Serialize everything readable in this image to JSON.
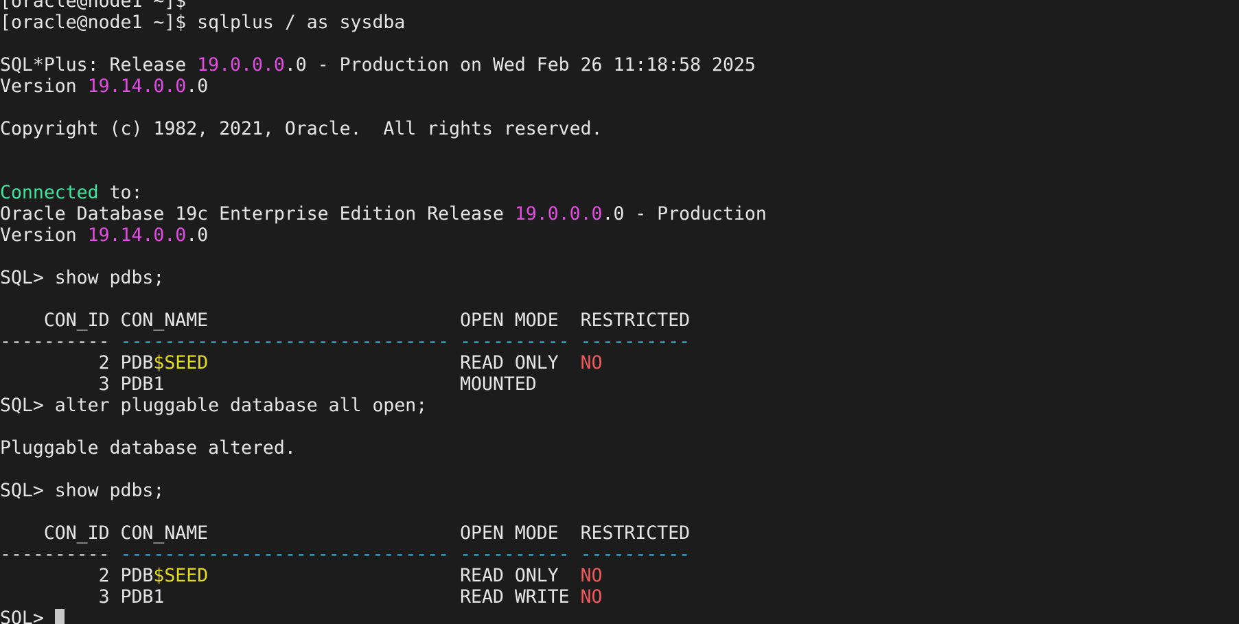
{
  "terminal": {
    "colors": {
      "background": "#1c1c1c",
      "foreground": "#e6e6e6",
      "magenta": "#e44de4",
      "green": "#3ee6a0",
      "yellow": "#e6dc1e",
      "red": "#f05a5a",
      "cyan": "#3fb4d8"
    },
    "lines": [
      [
        {
          "t": "[oracle@node1 ~]$ ",
          "c": "default"
        }
      ],
      [
        {
          "t": "[oracle@node1 ~]$ sqlplus / as sysdba",
          "c": "default"
        }
      ],
      [],
      [
        {
          "t": "SQL*Plus: Release ",
          "c": "default"
        },
        {
          "t": "19.0.0.0",
          "c": "magenta"
        },
        {
          "t": ".0 - Production on Wed Feb 26 11:18:58 2025",
          "c": "default"
        }
      ],
      [
        {
          "t": "Version ",
          "c": "default"
        },
        {
          "t": "19.14.0.0",
          "c": "magenta"
        },
        {
          "t": ".0",
          "c": "default"
        }
      ],
      [],
      [
        {
          "t": "Copyright (c) 1982, 2021, Oracle.  All rights reserved.",
          "c": "default"
        }
      ],
      [],
      [],
      [
        {
          "t": "Connected",
          "c": "green"
        },
        {
          "t": " to:",
          "c": "default"
        }
      ],
      [
        {
          "t": "Oracle Database 19c Enterprise Edition Release ",
          "c": "default"
        },
        {
          "t": "19.0.0.0",
          "c": "magenta"
        },
        {
          "t": ".0 - Production",
          "c": "default"
        }
      ],
      [
        {
          "t": "Version ",
          "c": "default"
        },
        {
          "t": "19.14.0.0",
          "c": "magenta"
        },
        {
          "t": ".0",
          "c": "default"
        }
      ],
      [],
      [
        {
          "t": "SQL> show pdbs;",
          "c": "default"
        }
      ],
      [],
      [
        {
          "t": "    CON_ID CON_NAME                       OPEN MODE  RESTRICTED",
          "c": "default"
        }
      ],
      [
        {
          "t": "---------- ",
          "c": "default"
        },
        {
          "t": "------------------------------ ---------- ----------",
          "c": "cyan"
        }
      ],
      [
        {
          "t": "         2 PDB",
          "c": "default"
        },
        {
          "t": "$SEED",
          "c": "yellow"
        },
        {
          "t": "                       READ ONLY  ",
          "c": "default"
        },
        {
          "t": "NO",
          "c": "red"
        }
      ],
      [
        {
          "t": "         3 PDB1                           MOUNTED",
          "c": "default"
        }
      ],
      [
        {
          "t": "SQL> alter pluggable database all open;",
          "c": "default"
        }
      ],
      [],
      [
        {
          "t": "Pluggable database altered.",
          "c": "default"
        }
      ],
      [],
      [
        {
          "t": "SQL> show pdbs;",
          "c": "default"
        }
      ],
      [],
      [
        {
          "t": "    CON_ID CON_NAME                       OPEN MODE  RESTRICTED",
          "c": "default"
        }
      ],
      [
        {
          "t": "---------- ",
          "c": "default"
        },
        {
          "t": "------------------------------ ---------- ----------",
          "c": "cyan"
        }
      ],
      [
        {
          "t": "         2 PDB",
          "c": "default"
        },
        {
          "t": "$SEED",
          "c": "yellow"
        },
        {
          "t": "                       READ ONLY  ",
          "c": "default"
        },
        {
          "t": "NO",
          "c": "red"
        }
      ],
      [
        {
          "t": "         3 PDB1                           READ WRITE ",
          "c": "default"
        },
        {
          "t": "NO",
          "c": "red"
        }
      ],
      [
        {
          "t": "SQL> ",
          "c": "default"
        },
        {
          "cursor": true
        }
      ]
    ]
  }
}
